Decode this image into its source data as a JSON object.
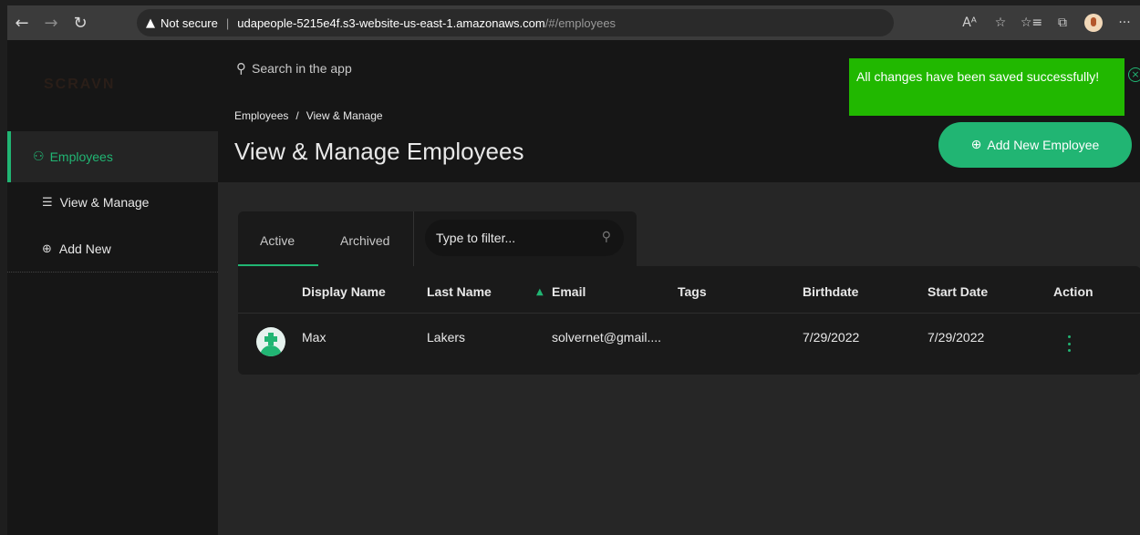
{
  "browser": {
    "not_secure": "Not secure",
    "url_host": "udapeople-5215e4f.s3-website-us-east-1.amazonaws.com",
    "url_path": "/#/employees",
    "icons": [
      "back-icon",
      "forward-icon",
      "refresh-icon",
      "read-aloud-icon",
      "favorite-icon",
      "favorites-icon",
      "collections-icon",
      "profile-icon",
      "more-icon"
    ]
  },
  "sidebar": {
    "logo": "SCRAVN",
    "active_item": "Employees",
    "items": [
      {
        "label": "View & Manage",
        "icon": "list-icon"
      },
      {
        "label": "Add New",
        "icon": "plus-circle-icon"
      }
    ]
  },
  "header": {
    "search_placeholder": "Search in the app",
    "breadcrumb": [
      "Employees",
      "View & Manage"
    ],
    "breadcrumb_separator": "/",
    "title": "View & Manage Employees",
    "add_button": "Add New Employee"
  },
  "toast": {
    "message": "All changes have been saved successfully!",
    "color": "#21b800"
  },
  "tabs": {
    "active": "Active",
    "archived": "Archived",
    "filter_placeholder": "Type to filter..."
  },
  "table": {
    "columns": [
      "Display Name",
      "Last Name",
      "Email",
      "Tags",
      "Birthdate",
      "Start Date",
      "Action"
    ],
    "rows": [
      {
        "display_name": "Max",
        "last_name": "Lakers",
        "email": "solvernet@gmail....",
        "tags": "",
        "birthdate": "7/29/2022",
        "start_date": "7/29/2022"
      }
    ]
  },
  "colors": {
    "accent": "#21b573",
    "sidebar_bg": "#161616",
    "main_bg": "#262626"
  }
}
